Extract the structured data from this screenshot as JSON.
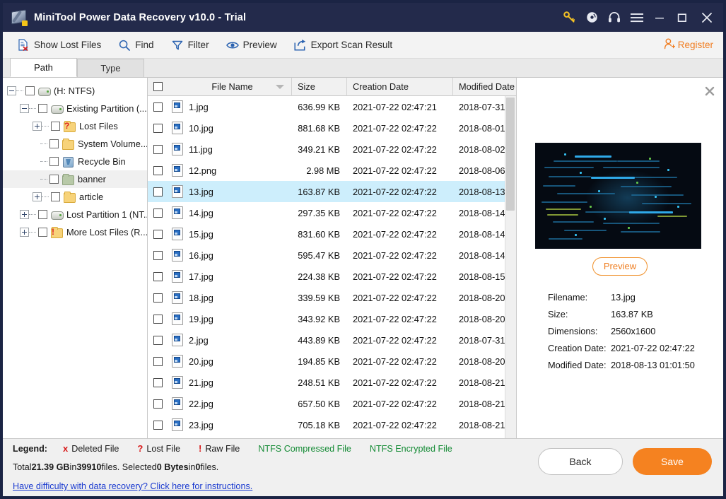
{
  "titlebar": {
    "title": "MiniTool Power Data Recovery v10.0 - Trial",
    "icons": [
      {
        "name": "key-icon",
        "label": "Key"
      },
      {
        "name": "disc-icon",
        "label": "Bootable Media"
      },
      {
        "name": "headset-icon",
        "label": "Support"
      },
      {
        "name": "hamburger-menu-icon",
        "label": "Menu"
      },
      {
        "name": "minimize-icon",
        "label": "Minimize"
      },
      {
        "name": "maximize-icon",
        "label": "Maximize"
      },
      {
        "name": "close-icon",
        "label": "Close"
      }
    ]
  },
  "toolbar": {
    "show_lost_files": "Show Lost Files",
    "find": "Find",
    "filter": "Filter",
    "preview": "Preview",
    "export_scan_result": "Export Scan Result",
    "register": "Register"
  },
  "tabs": [
    {
      "label": "Path",
      "active": true
    },
    {
      "label": "Type",
      "active": false
    }
  ],
  "tree": [
    {
      "label": "(H: NTFS)",
      "indent": 0,
      "expander": "minus",
      "icon": "drive-icon",
      "selected": false
    },
    {
      "label": "Existing Partition (...",
      "indent": 1,
      "expander": "minus",
      "icon": "drive-icon",
      "selected": false
    },
    {
      "label": "Lost Files",
      "indent": 2,
      "expander": "plus",
      "icon": "folder-question-icon",
      "selected": false
    },
    {
      "label": "System Volume...",
      "indent": 2,
      "expander": "none",
      "icon": "folder-icon",
      "selected": false
    },
    {
      "label": "Recycle Bin",
      "indent": 2,
      "expander": "none",
      "icon": "recycle-bin-icon",
      "selected": false
    },
    {
      "label": "banner",
      "indent": 2,
      "expander": "none",
      "icon": "folder-green-icon",
      "selected": true
    },
    {
      "label": "article",
      "indent": 2,
      "expander": "plus",
      "icon": "folder-icon",
      "selected": false
    },
    {
      "label": "Lost Partition 1 (NT...",
      "indent": 1,
      "expander": "plus",
      "icon": "drive-icon",
      "selected": false
    },
    {
      "label": "More Lost Files (R...",
      "indent": 1,
      "expander": "plus",
      "icon": "folder-exclaim-icon",
      "selected": false
    }
  ],
  "filelist": {
    "columns": [
      "File Name",
      "Size",
      "Creation Date",
      "Modified Date"
    ],
    "sorted_column": "File Name",
    "rows": [
      {
        "name": "1.jpg",
        "size": "636.99 KB",
        "created": "2021-07-22 02:47:21",
        "modified": "2018-07-31...",
        "selected": false
      },
      {
        "name": "10.jpg",
        "size": "881.68 KB",
        "created": "2021-07-22 02:47:22",
        "modified": "2018-08-01...",
        "selected": false
      },
      {
        "name": "11.jpg",
        "size": "349.21 KB",
        "created": "2021-07-22 02:47:22",
        "modified": "2018-08-02...",
        "selected": false
      },
      {
        "name": "12.png",
        "size": "2.98 MB",
        "created": "2021-07-22 02:47:22",
        "modified": "2018-08-06...",
        "selected": false
      },
      {
        "name": "13.jpg",
        "size": "163.87 KB",
        "created": "2021-07-22 02:47:22",
        "modified": "2018-08-13...",
        "selected": true
      },
      {
        "name": "14.jpg",
        "size": "297.35 KB",
        "created": "2021-07-22 02:47:22",
        "modified": "2018-08-14...",
        "selected": false
      },
      {
        "name": "15.jpg",
        "size": "831.60 KB",
        "created": "2021-07-22 02:47:22",
        "modified": "2018-08-14...",
        "selected": false
      },
      {
        "name": "16.jpg",
        "size": "595.47 KB",
        "created": "2021-07-22 02:47:22",
        "modified": "2018-08-14...",
        "selected": false
      },
      {
        "name": "17.jpg",
        "size": "224.38 KB",
        "created": "2021-07-22 02:47:22",
        "modified": "2018-08-15...",
        "selected": false
      },
      {
        "name": "18.jpg",
        "size": "339.59 KB",
        "created": "2021-07-22 02:47:22",
        "modified": "2018-08-20...",
        "selected": false
      },
      {
        "name": "19.jpg",
        "size": "343.92 KB",
        "created": "2021-07-22 02:47:22",
        "modified": "2018-08-20...",
        "selected": false
      },
      {
        "name": "2.jpg",
        "size": "443.89 KB",
        "created": "2021-07-22 02:47:22",
        "modified": "2018-07-31...",
        "selected": false
      },
      {
        "name": "20.jpg",
        "size": "194.85 KB",
        "created": "2021-07-22 02:47:22",
        "modified": "2018-08-20...",
        "selected": false
      },
      {
        "name": "21.jpg",
        "size": "248.51 KB",
        "created": "2021-07-22 02:47:22",
        "modified": "2018-08-21...",
        "selected": false
      },
      {
        "name": "22.jpg",
        "size": "657.50 KB",
        "created": "2021-07-22 02:47:22",
        "modified": "2018-08-21...",
        "selected": false
      },
      {
        "name": "23.jpg",
        "size": "705.18 KB",
        "created": "2021-07-22 02:47:22",
        "modified": "2018-08-21...",
        "selected": false
      }
    ]
  },
  "preview": {
    "button_label": "Preview",
    "fields": [
      {
        "key": "Filename:",
        "value": "13.jpg"
      },
      {
        "key": "Size:",
        "value": "163.87 KB"
      },
      {
        "key": "Dimensions:",
        "value": "2560x1600"
      },
      {
        "key": "Creation Date:",
        "value": "2021-07-22 02:47:22"
      },
      {
        "key": "Modified Date:",
        "value": "2018-08-13 01:01:50"
      }
    ]
  },
  "legend": {
    "title": "Legend:",
    "deleted_mark": "x",
    "deleted": "Deleted File",
    "lost_mark": "?",
    "lost": "Lost File",
    "raw_mark": "!",
    "raw": "Raw File",
    "compressed": "NTFS Compressed File",
    "encrypted": "NTFS Encrypted File"
  },
  "status": {
    "total_prefix": "Total ",
    "total_size": "21.39 GB",
    "in_word": " in ",
    "file_count": "39910",
    "files_word": " files.  Selected ",
    "selected_size": "0 Bytes",
    "selected_in": " in ",
    "selected_count": "0",
    "suffix": " files."
  },
  "help_link": "Have difficulty with data recovery? Click here for instructions.",
  "buttons": {
    "back": "Back",
    "save": "Save"
  },
  "colors": {
    "titlebar": "#232a4b",
    "accent_orange": "#f58220",
    "selection_blue": "#cdeefc",
    "link_blue": "#1a3ad0",
    "legend_green": "#148b35",
    "legend_red": "#d81b1b"
  }
}
